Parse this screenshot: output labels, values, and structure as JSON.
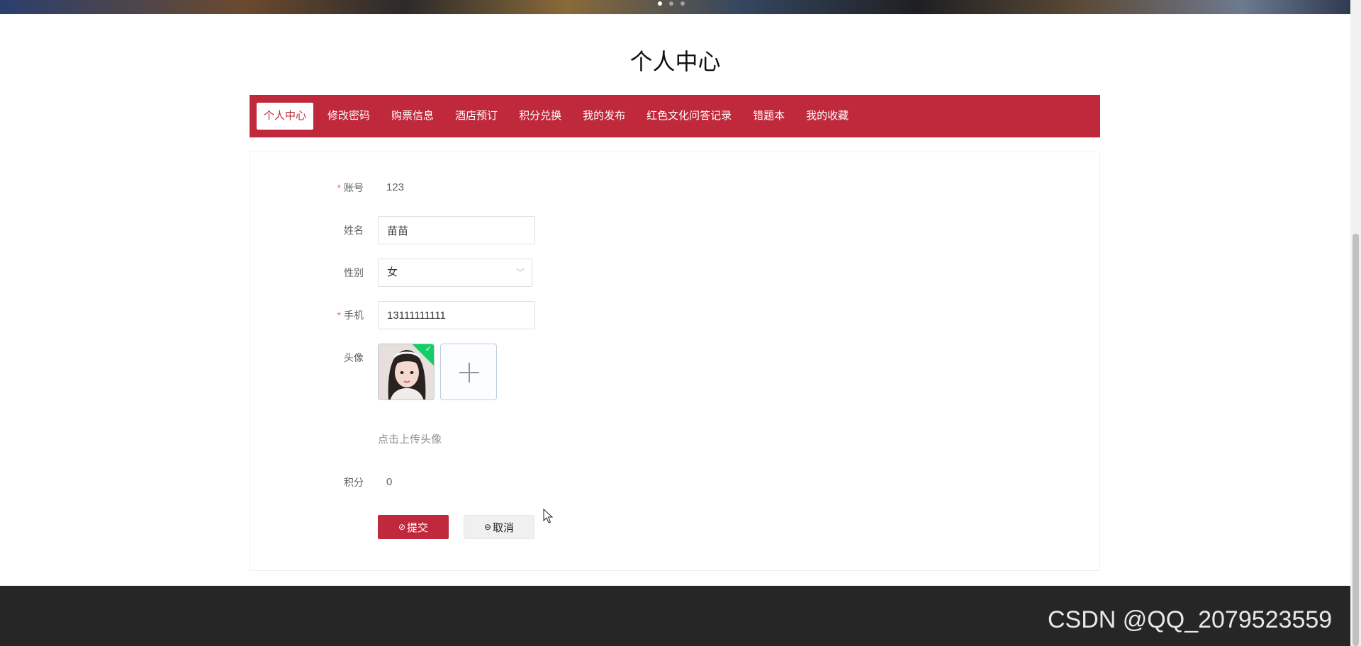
{
  "page": {
    "title": "个人中心"
  },
  "nav": {
    "tabs": [
      {
        "label": "个人中心",
        "active": true
      },
      {
        "label": "修改密码"
      },
      {
        "label": "购票信息"
      },
      {
        "label": "酒店预订"
      },
      {
        "label": "积分兑换"
      },
      {
        "label": "我的发布"
      },
      {
        "label": "红色文化问答记录"
      },
      {
        "label": "错题本"
      },
      {
        "label": "我的收藏"
      }
    ]
  },
  "form": {
    "required_mark": "*",
    "account": {
      "label": "账号",
      "value": "123"
    },
    "name": {
      "label": "姓名",
      "value": "苗苗"
    },
    "gender": {
      "label": "性别",
      "value": "女"
    },
    "phone": {
      "label": "手机",
      "value": "13111111111"
    },
    "avatar": {
      "label": "头像",
      "upload_tip": "点击上传头像"
    },
    "points": {
      "label": "积分",
      "value": "0"
    },
    "submit_label": "提交",
    "cancel_label": "取消"
  },
  "watermark": {
    "text": "CSDN @QQ_2079523559"
  },
  "colors": {
    "brand": "#c0283b",
    "footer": "#262626",
    "success": "#13ce66"
  },
  "icons": {
    "submit": "check-circle-icon",
    "cancel": "minus-circle-icon",
    "upload": "plus-icon",
    "select": "chevron-down-icon"
  }
}
